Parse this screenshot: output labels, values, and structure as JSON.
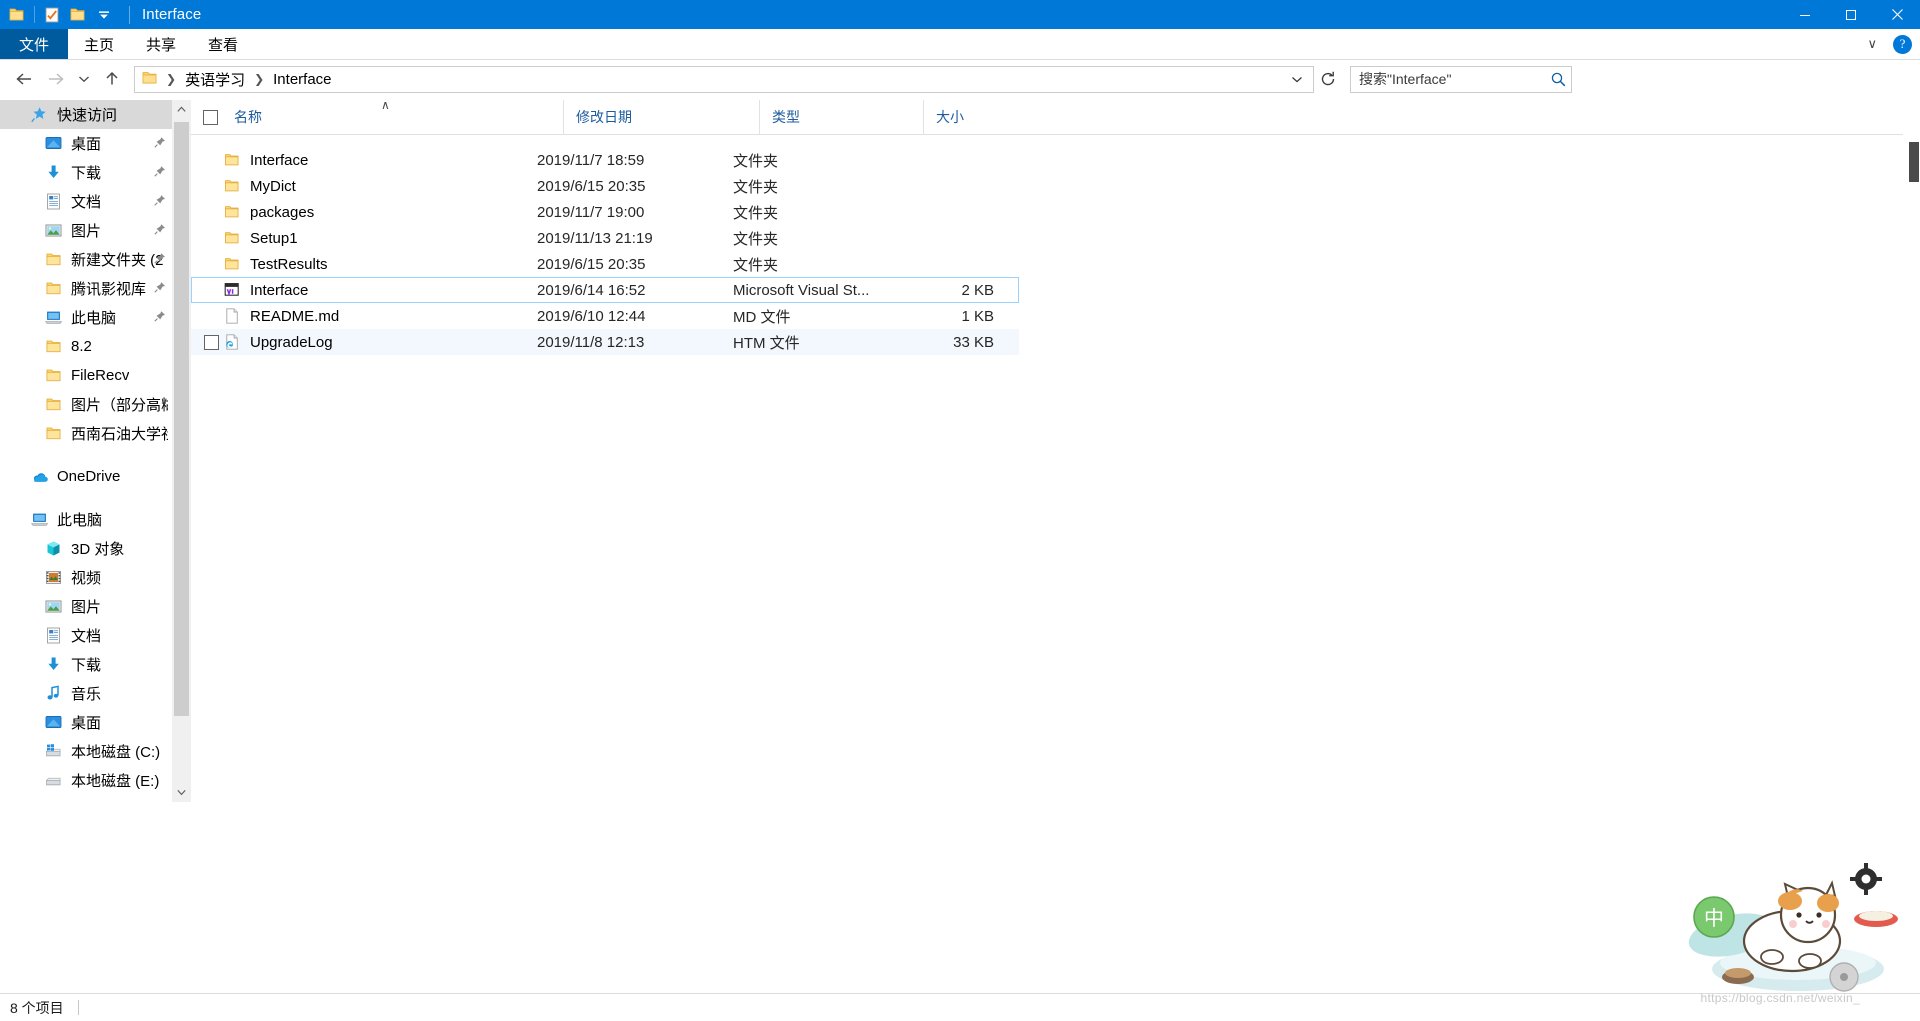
{
  "window": {
    "title": "Interface",
    "quick_access": [
      {
        "name": "folder-icon",
        "label": "文件夹"
      },
      {
        "name": "properties-icon",
        "label": "属性"
      },
      {
        "name": "new-folder-icon",
        "label": "新建文件夹"
      },
      {
        "name": "customize-dropdown-icon",
        "label": "自定义快速访问工具栏"
      }
    ],
    "controls": {
      "minimize": "—",
      "maximize": "▢",
      "close": "✕"
    }
  },
  "ribbon": {
    "file_tab": "文件",
    "tabs": [
      "主页",
      "共享",
      "查看"
    ],
    "collapse_label": "∨",
    "help_label": "?"
  },
  "addressbar": {
    "back": "←",
    "forward": "→",
    "recent": "∨",
    "up": "↑",
    "breadcrumbs": [
      "英语学习",
      "Interface"
    ],
    "dropdown": "∨",
    "refresh": "↻",
    "search_placeholder": "搜索\"Interface\"",
    "search_value": ""
  },
  "sidebar": {
    "groups": [
      {
        "header": {
          "label": "快速访问",
          "icon": "star-pin-icon",
          "selected": true
        },
        "items": [
          {
            "label": "桌面",
            "icon": "desktop-icon",
            "pinned": true
          },
          {
            "label": "下载",
            "icon": "download-icon",
            "pinned": true
          },
          {
            "label": "文档",
            "icon": "documents-icon",
            "pinned": true
          },
          {
            "label": "图片",
            "icon": "pictures-icon",
            "pinned": true
          },
          {
            "label": "新建文件夹 (2",
            "icon": "folder-icon",
            "pinned": true
          },
          {
            "label": "腾讯影视库",
            "icon": "folder-icon",
            "pinned": true
          },
          {
            "label": "此电脑",
            "icon": "computer-icon",
            "pinned": true
          },
          {
            "label": "8.2",
            "icon": "folder-icon",
            "pinned": false
          },
          {
            "label": "FileRecv",
            "icon": "folder-icon",
            "pinned": false
          },
          {
            "label": "图片（部分高糊",
            "icon": "folder-icon",
            "pinned": false
          },
          {
            "label": "西南石油大学社",
            "icon": "folder-icon",
            "pinned": false
          }
        ]
      },
      {
        "header": {
          "label": "OneDrive",
          "icon": "onedrive-icon",
          "selected": false
        },
        "items": []
      },
      {
        "header": {
          "label": "此电脑",
          "icon": "computer-icon",
          "selected": false
        },
        "items": [
          {
            "label": "3D 对象",
            "icon": "3d-objects-icon",
            "pinned": false
          },
          {
            "label": "视频",
            "icon": "videos-icon",
            "pinned": false
          },
          {
            "label": "图片",
            "icon": "pictures-icon",
            "pinned": false
          },
          {
            "label": "文档",
            "icon": "documents-icon",
            "pinned": false
          },
          {
            "label": "下载",
            "icon": "download-icon",
            "pinned": false
          },
          {
            "label": "音乐",
            "icon": "music-icon",
            "pinned": false
          },
          {
            "label": "桌面",
            "icon": "desktop-icon",
            "pinned": false
          },
          {
            "label": "本地磁盘 (C:)",
            "icon": "system-drive-icon",
            "pinned": false
          },
          {
            "label": "本地磁盘 (E:)",
            "icon": "drive-icon",
            "pinned": false
          }
        ]
      }
    ],
    "scroll_up": "∧",
    "scroll_down": "∨"
  },
  "filelist": {
    "columns": [
      {
        "key": "name",
        "label": "名称",
        "sorted": true,
        "sort_dir": "asc"
      },
      {
        "key": "date",
        "label": "修改日期"
      },
      {
        "key": "type",
        "label": "类型"
      },
      {
        "key": "size",
        "label": "大小"
      }
    ],
    "sort_caret": "∧",
    "rows": [
      {
        "name": "Interface",
        "date": "2019/11/7 18:59",
        "type": "文件夹",
        "size": "",
        "icon": "folder-icon",
        "state": "normal",
        "checkbox": false
      },
      {
        "name": "MyDict",
        "date": "2019/6/15 20:35",
        "type": "文件夹",
        "size": "",
        "icon": "folder-icon",
        "state": "normal",
        "checkbox": false
      },
      {
        "name": "packages",
        "date": "2019/11/7 19:00",
        "type": "文件夹",
        "size": "",
        "icon": "folder-icon",
        "state": "normal",
        "checkbox": false
      },
      {
        "name": "Setup1",
        "date": "2019/11/13 21:19",
        "type": "文件夹",
        "size": "",
        "icon": "folder-icon",
        "state": "normal",
        "checkbox": false
      },
      {
        "name": "TestResults",
        "date": "2019/6/15 20:35",
        "type": "文件夹",
        "size": "",
        "icon": "folder-icon",
        "state": "normal",
        "checkbox": false
      },
      {
        "name": "Interface",
        "date": "2019/6/14 16:52",
        "type": "Microsoft Visual St...",
        "size": "2 KB",
        "icon": "visual-studio-solution-icon",
        "state": "selected",
        "checkbox": false
      },
      {
        "name": "README.md",
        "date": "2019/6/10 12:44",
        "type": "MD 文件",
        "size": "1 KB",
        "icon": "generic-file-icon",
        "state": "normal",
        "checkbox": false
      },
      {
        "name": "UpgradeLog",
        "date": "2019/11/8 12:13",
        "type": "HTM 文件",
        "size": "33 KB",
        "icon": "edge-html-icon",
        "state": "hovered",
        "checkbox": true
      }
    ]
  },
  "statusbar": {
    "item_count": "8 个项目"
  },
  "watermark": {
    "text": "https://blog.csdn.net/weixin_",
    "badge": "中"
  },
  "colors": {
    "accent": "#0078d7",
    "file_tab": "#005a9e",
    "selection_border": "#99d1ff",
    "hover_row": "#f2f8fd",
    "sidebar_selected": "#d9d9d9",
    "column_header_text": "#1d5b9e",
    "folder_yellow": "#ffd264"
  }
}
